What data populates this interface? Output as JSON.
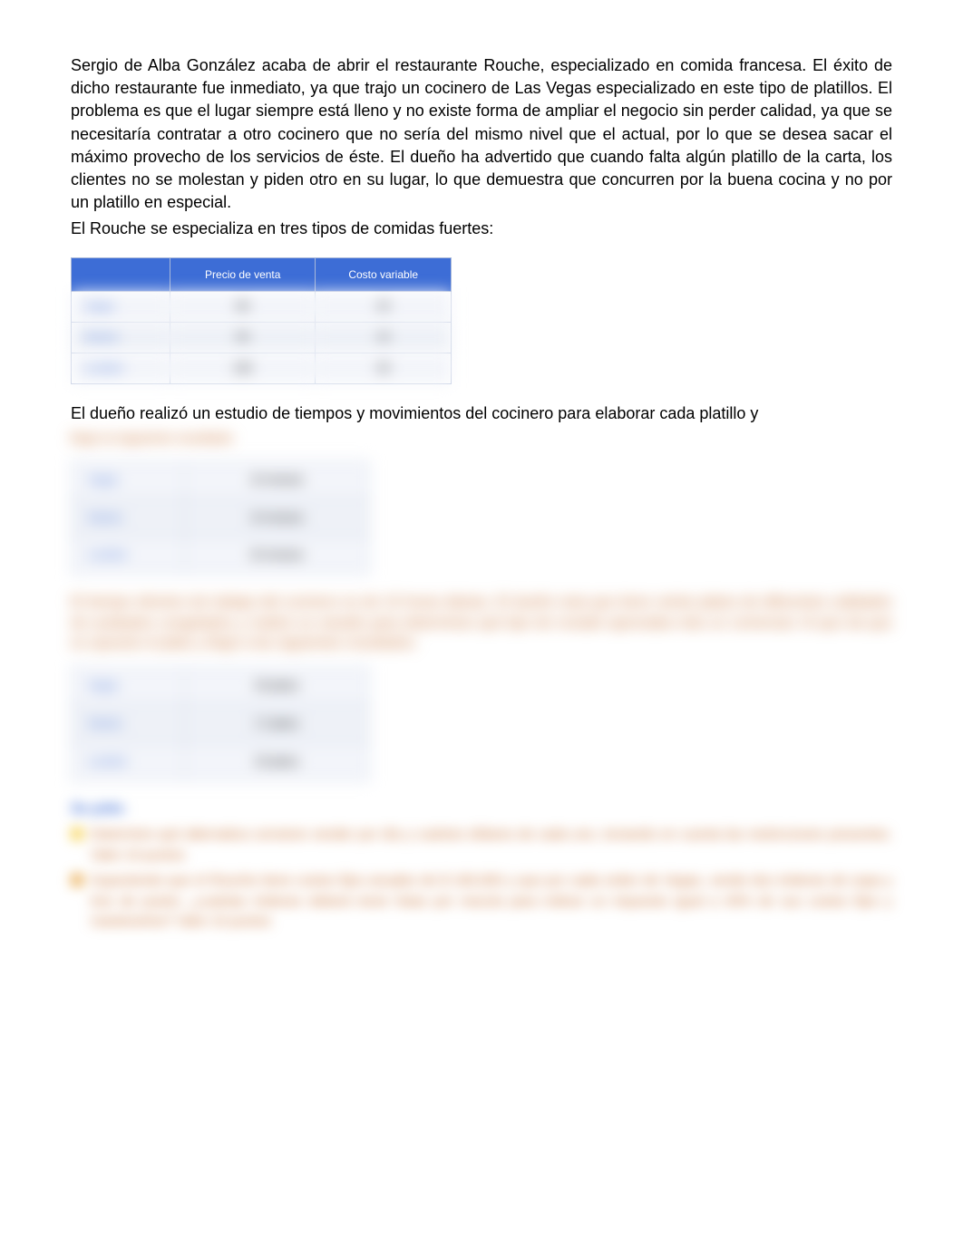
{
  "para1": "Sergio de Alba González acaba de abrir el restaurante Rouche, especializado en comida francesa. El éxito de dicho restaurante fue inmediato, ya que trajo un cocinero de Las Vegas especializado en este tipo de platillos. El problema es que el lugar siempre está lleno y no existe forma de ampliar el negocio sin perder calidad, ya que se necesitaría contratar a otro cocinero que no sería del mismo nivel que el actual, por lo que se desea sacar el máximo provecho de los servicios de éste. El dueño ha advertido que cuando falta algún platillo de la carta, los clientes no se molestan y piden otro en su lugar, lo que demuestra que concurren por la buena cocina y no por un platillo en especial.",
  "line1": "El Rouche se especializa en tres tipos de comidas fuertes:",
  "table1": {
    "headers": [
      "",
      "Precio de venta",
      "Costo variable"
    ],
    "rows": [
      {
        "label": "Vegas",
        "v1": "80",
        "v2": "20"
      },
      {
        "label": "Nantes",
        "v1": "55",
        "v2": "15"
      },
      {
        "label": "Lumière",
        "v1": "105",
        "v2": "30"
      }
    ]
  },
  "line2": "El dueño realizó un estudio de tiempos y movimientos del cocinero para elaborar cada platillo y",
  "blurred_text_a": "llegó al siguiente resultado:",
  "table2": {
    "rows": [
      {
        "label": "Vegas",
        "v1": "15 minutos"
      },
      {
        "label": "Nantes",
        "v1": "10 minutos"
      },
      {
        "label": "Lumière",
        "v1": "20 minutos"
      }
    ]
  },
  "blurred_text_b": "El tiempo efectivo de trabajo del cocinero es de 10 horas diarias. El dueño nota que tiene veinte platos de diferentes calidades de acabados congelados y realizó un estudio para determinar qué tipo de rociado apreciaba más un comensal. Al que da que es opuesto el plato y llegó a las siguientes resultados:",
  "table3": {
    "rows": [
      {
        "label": "Vegas",
        "v1": "30 platos"
      },
      {
        "label": "Nantes",
        "v1": "17 platos"
      },
      {
        "label": "Lumière",
        "v1": "20 platos"
      }
    ]
  },
  "pide": {
    "title": "Se pide:",
    "item1": "Determine qué alternativa conviene vender por día y cuántos dólares de cada uno, tomando en cuenta las restricciones presentes.            Valor 10 puntos",
    "item2": "Suponiendo que el Rouche tiene costos fijos anuales de $ 160,000 y que por cada orden de Vegas, vende dos órdenes de sopa y tres de postre, ¿cuántas órdenes deberá tener listas por mezcla para indicar un impuesto igual a 40% de sus costos fijos y mantenerlos?              Valor 10 puntos"
  }
}
